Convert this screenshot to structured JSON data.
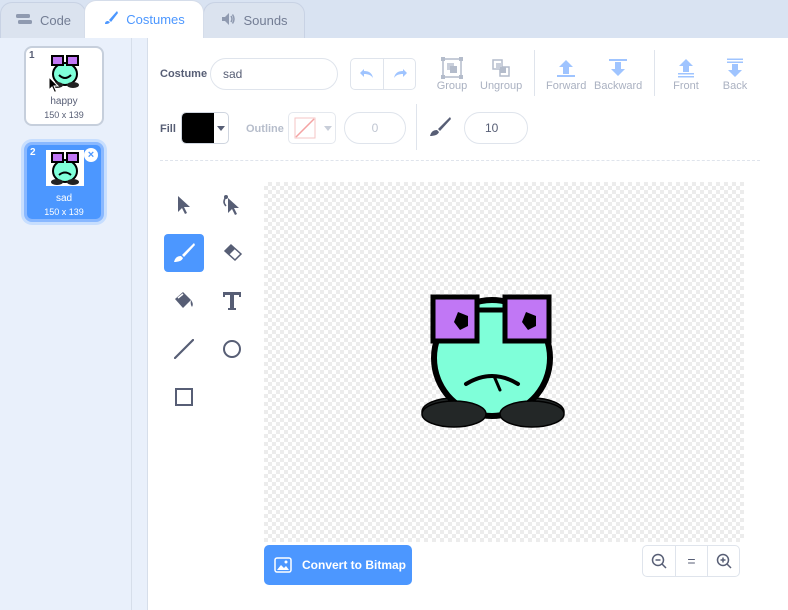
{
  "tabs": [
    {
      "label": "Code",
      "icon": "code-icon"
    },
    {
      "label": "Costumes",
      "icon": "brush-icon"
    },
    {
      "label": "Sounds",
      "icon": "speaker-icon"
    }
  ],
  "costumes": [
    {
      "number": "1",
      "name": "happy",
      "size": "150 x 139"
    },
    {
      "number": "2",
      "name": "sad",
      "size": "150 x 139"
    }
  ],
  "toolbar": {
    "costume_label": "Costume",
    "costume_name": "sad",
    "group_label": "Group",
    "ungroup_label": "Ungroup",
    "forward_label": "Forward",
    "backward_label": "Backward",
    "front_label": "Front",
    "back_label": "Back",
    "fill_label": "Fill",
    "outline_label": "Outline",
    "outline_width": "0",
    "brush_size": "10"
  },
  "colors": {
    "accent": "#4c97ff",
    "fill": "#000000",
    "sprite_body": "#7fffd9",
    "sprite_glasses": "#c177f5"
  },
  "convert_button": "Convert to Bitmap",
  "zoom": {
    "out": "−",
    "reset": "=",
    "in": "+"
  }
}
